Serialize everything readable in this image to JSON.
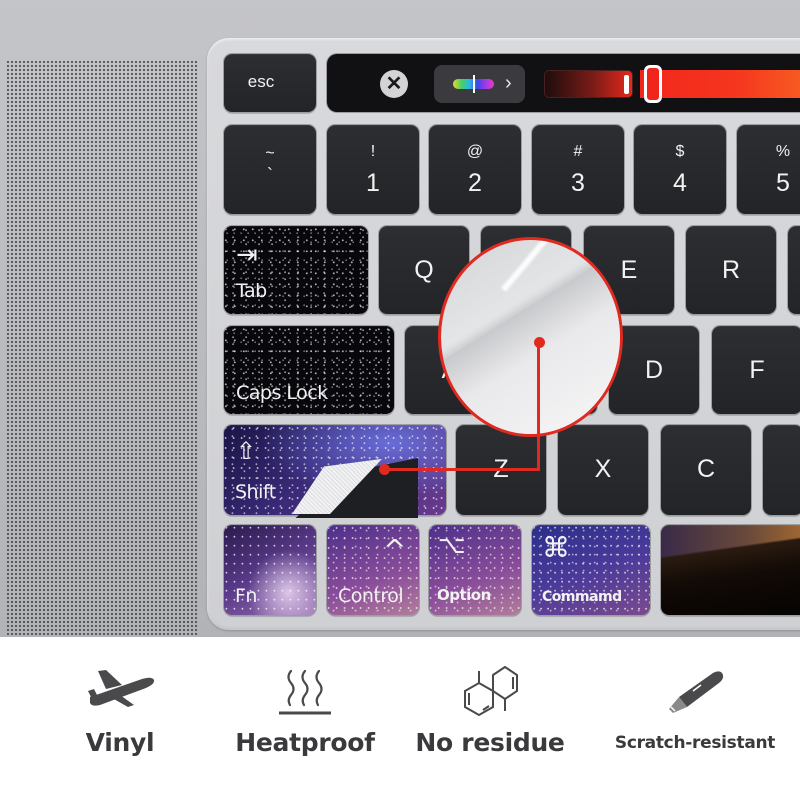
{
  "touchbar": {
    "esc_label": "esc",
    "close_icon": "close-icon",
    "color_picker_icon": "color-spectrum-icon",
    "chevron_glyph": "›",
    "close_glyph": "✕",
    "brightness_value_fraction": 0.1,
    "accent_color": "#f0261c"
  },
  "number_row": [
    {
      "top": "~",
      "bottom": "`"
    },
    {
      "top": "!",
      "bottom": "1"
    },
    {
      "top": "@",
      "bottom": "2"
    },
    {
      "top": "#",
      "bottom": "3"
    },
    {
      "top": "$",
      "bottom": "4"
    },
    {
      "top": "%",
      "bottom": "5"
    }
  ],
  "keys": {
    "tab": {
      "glyph": "⇥",
      "label": "Tab"
    },
    "q": "Q",
    "e": "E",
    "r": "R",
    "caps_lock": {
      "label": "Caps Lock"
    },
    "a": "A",
    "d": "D",
    "f": "F",
    "shift": {
      "glyph": "⇧",
      "label": "Shift"
    },
    "z": "Z",
    "x": "X",
    "c": "C",
    "fn": {
      "label": "Fn"
    },
    "control": {
      "glyph": "^",
      "label": "Control"
    },
    "option": {
      "glyph": "⌥",
      "label": "Option"
    },
    "command": {
      "glyph": "⌘",
      "label": "Commamd"
    }
  },
  "callout": {
    "color": "#e02a20"
  },
  "features": [
    {
      "icon": "airplane-icon",
      "label": "Vinyl"
    },
    {
      "icon": "heat-waves-icon",
      "label": "Heatproof"
    },
    {
      "icon": "chemical-molecule-icon",
      "label": "No residue"
    },
    {
      "icon": "utility-knife-icon",
      "label": "Scratch-resistant"
    }
  ]
}
